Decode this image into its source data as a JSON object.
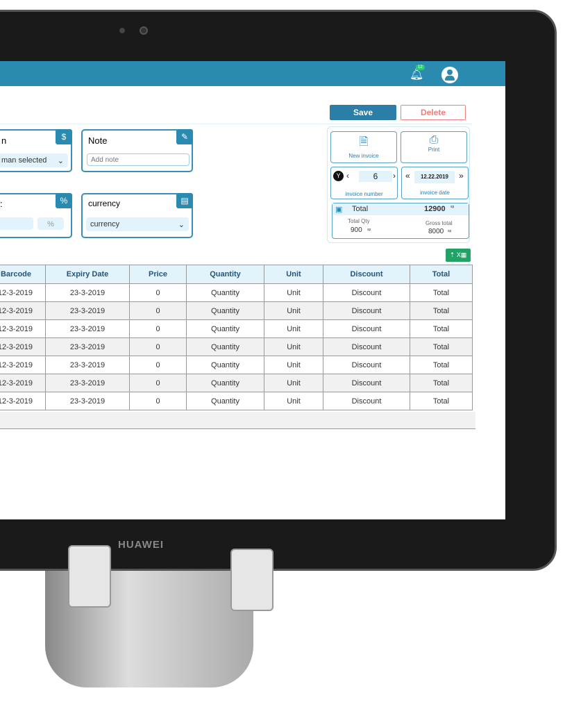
{
  "device": {
    "brand": "HUAWEI"
  },
  "header": {
    "notification_count": "12"
  },
  "actions": {
    "save": "Save",
    "delete": "Delete"
  },
  "cards": {
    "salesman": {
      "label": "n",
      "value": "man selected"
    },
    "note": {
      "label": "Note",
      "placeholder": "Add note"
    },
    "discount": {
      "label": ":",
      "percent_placeholder": "%"
    },
    "currency": {
      "label": "currency",
      "value": "currency"
    }
  },
  "panel": {
    "new_invoice": "New invoice",
    "print": "Print",
    "invoice_number_value": "6",
    "invoice_number_label": "invoice number",
    "invoice_date_value": "12.22.2019",
    "invoice_date_label": "invoice date",
    "total_label": "Total",
    "total_value": "12900",
    "total_unit": "sp",
    "total_qty_label": "Total Qty",
    "total_qty_value": "900",
    "total_qty_unit": "sp",
    "gross_total_label": "Gross total",
    "gross_total_value": "8000",
    "gross_total_unit": "sp"
  },
  "table": {
    "columns": [
      "Barcode",
      "Expiry Date",
      "Price",
      "Quantity",
      "Unit",
      "Discount",
      "Total"
    ],
    "rows": [
      [
        "12-3-2019",
        "23-3-2019",
        "0",
        "Quantity",
        "Unit",
        "Discount",
        "Total"
      ],
      [
        "12-3-2019",
        "23-3-2019",
        "0",
        "Quantity",
        "Unit",
        "Discount",
        "Total"
      ],
      [
        "12-3-2019",
        "23-3-2019",
        "0",
        "Quantity",
        "Unit",
        "Discount",
        "Total"
      ],
      [
        "12-3-2019",
        "23-3-2019",
        "0",
        "Quantity",
        "Unit",
        "Discount",
        "Total"
      ],
      [
        "12-3-2019",
        "23-3-2019",
        "0",
        "Quantity",
        "Unit",
        "Discount",
        "Total"
      ],
      [
        "12-3-2019",
        "23-3-2019",
        "0",
        "Quantity",
        "Unit",
        "Discount",
        "Total"
      ],
      [
        "12-3-2019",
        "23-3-2019",
        "0",
        "Quantity",
        "Unit",
        "Discount",
        "Total"
      ]
    ]
  },
  "colors": {
    "primary": "#2a8ab0",
    "delete": "#f08080",
    "excel": "#21a366",
    "badge": "#2ecc71"
  }
}
